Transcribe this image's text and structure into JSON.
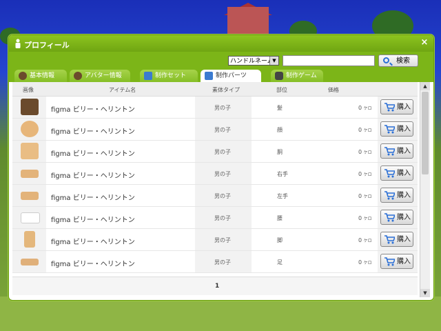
{
  "window": {
    "title": "プロフィール",
    "close": "×"
  },
  "search": {
    "select_value": "ハンドルネーム",
    "button_label": "検索",
    "input_value": ""
  },
  "tabs": [
    {
      "label": "基本情報",
      "active": false
    },
    {
      "label": "アバター情報",
      "active": false
    },
    {
      "label": "制作セット",
      "active": false
    },
    {
      "label": "制作パーツ",
      "active": true
    },
    {
      "label": "制作ゲーム",
      "active": false
    }
  ],
  "columns": {
    "image": "画像",
    "item_name": "アイテム名",
    "body_type": "素体タイプ",
    "part": "部位",
    "price": "価格"
  },
  "rows": [
    {
      "name": "figma ビリー・ヘリントン",
      "type": "男の子",
      "part": "髪",
      "price": "0",
      "unit": "ケロ",
      "buy": "購入",
      "thumb": "hair-thumbnail",
      "color": "#6a4a2c"
    },
    {
      "name": "figma ビリー・ヘリントン",
      "type": "男の子",
      "part": "顔",
      "price": "0",
      "unit": "ケロ",
      "buy": "購入",
      "thumb": "face-thumbnail",
      "color": "#e7b67a"
    },
    {
      "name": "figma ビリー・ヘリントン",
      "type": "男の子",
      "part": "胴",
      "price": "0",
      "unit": "ケロ",
      "buy": "購入",
      "thumb": "torso-thumbnail",
      "color": "#e9bd84"
    },
    {
      "name": "figma ビリー・ヘリントン",
      "type": "男の子",
      "part": "右手",
      "price": "0",
      "unit": "ケロ",
      "buy": "購入",
      "thumb": "right-hand-thumbnail",
      "color": "#e3b37a"
    },
    {
      "name": "figma ビリー・ヘリントン",
      "type": "男の子",
      "part": "左手",
      "price": "0",
      "unit": "ケロ",
      "buy": "購入",
      "thumb": "left-hand-thumbnail",
      "color": "#e3b37a"
    },
    {
      "name": "figma ビリー・ヘリントン",
      "type": "男の子",
      "part": "腰",
      "price": "0",
      "unit": "ケロ",
      "buy": "購入",
      "thumb": "waist-thumbnail",
      "color": "#f2f2f2"
    },
    {
      "name": "figma ビリー・ヘリントン",
      "type": "男の子",
      "part": "脚",
      "price": "0",
      "unit": "ケロ",
      "buy": "購入",
      "thumb": "legs-thumbnail",
      "color": "#e4b77c"
    },
    {
      "name": "figma ビリー・ヘリントン",
      "type": "男の子",
      "part": "足",
      "price": "0",
      "unit": "ケロ",
      "buy": "購入",
      "thumb": "feet-thumbnail",
      "color": "#e0b07a"
    }
  ],
  "pager": {
    "current": "1"
  },
  "colors": {
    "accent": "#7cb518",
    "titlebar": "#8dc41f",
    "cart": "#2a6fd6"
  }
}
